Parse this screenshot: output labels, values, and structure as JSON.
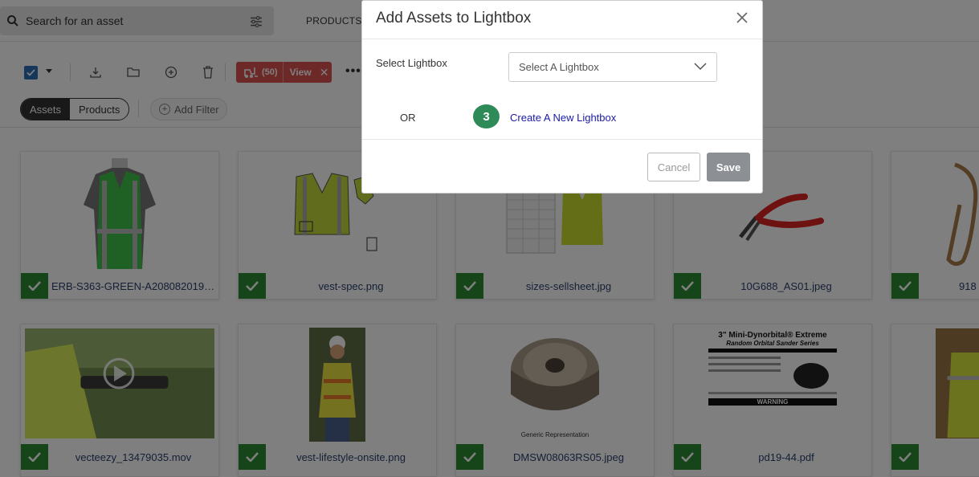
{
  "search": {
    "placeholder": "Search for an asset"
  },
  "topnav": {
    "products_label": "PRODUCTS"
  },
  "toolbar": {
    "selected_count": "(50)",
    "view_label": "View",
    "close_glyph": "✕",
    "more_glyph": "•••"
  },
  "filters": {
    "tabs": [
      {
        "label": "Assets",
        "active": true
      },
      {
        "label": "Products",
        "active": false
      }
    ],
    "add_filter_label": "Add Filter"
  },
  "assets": [
    {
      "filename": "ERB-S363-GREEN-A208082019.jp...",
      "thumb": "green-vest"
    },
    {
      "filename": "vest-spec.png",
      "thumb": "vest-spec"
    },
    {
      "filename": "sizes-sellsheet.jpg",
      "thumb": "size-sheet"
    },
    {
      "filename": "10G688_AS01.jpeg",
      "thumb": "pliers"
    },
    {
      "filename": "918",
      "thumb": "hook"
    },
    {
      "filename": "vecteezy_13479035.mov",
      "thumb": "video-worker"
    },
    {
      "filename": "vest-lifestyle-onsite.png",
      "thumb": "worker-photo"
    },
    {
      "filename": "DMSW08063RS05.jpeg",
      "thumb": "milling-cutter",
      "caption": "Generic Representation"
    },
    {
      "filename": "pd19-44.pdf",
      "thumb": "sander-doc",
      "doc_title": "3\" Mini-Dynorbital® Extreme",
      "doc_subtitle": "Random Orbital Sander Series",
      "doc_warning": "WARNING"
    },
    {
      "filename": "",
      "thumb": "warehouse"
    }
  ],
  "modal": {
    "title": "Add Assets to Lightbox",
    "select_label": "Select Lightbox",
    "select_placeholder": "Select A Lightbox",
    "or_label": "OR",
    "step_badge": "3",
    "create_link": "Create A New Lightbox",
    "cancel_label": "Cancel",
    "save_label": "Save"
  },
  "colors": {
    "accent_blue": "#2d6cb5",
    "check_green": "#2e8b34",
    "selection_red": "#d9534f",
    "step_green": "#2e8b57",
    "link_blue": "#1a1aa6"
  }
}
